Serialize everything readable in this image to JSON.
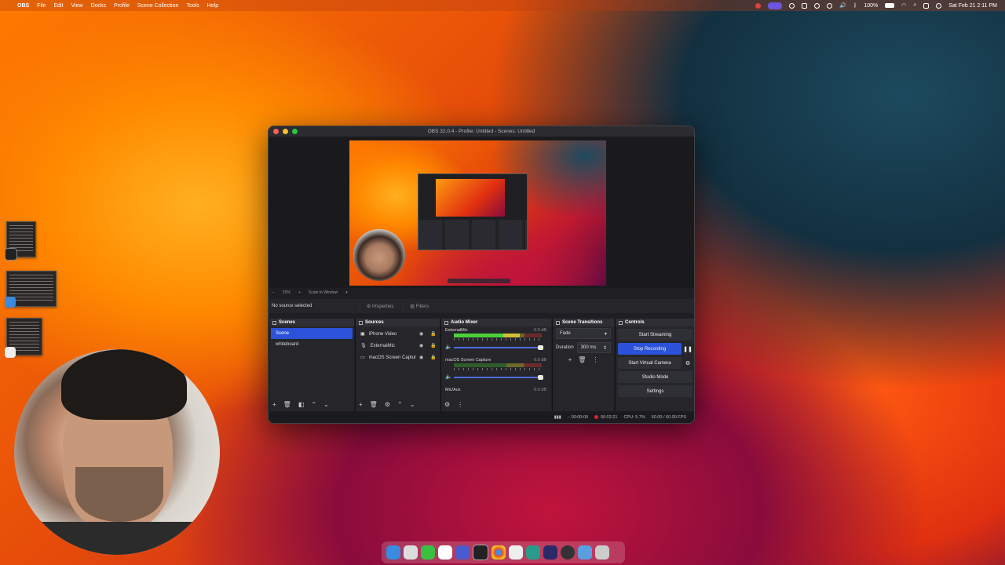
{
  "menubar": {
    "app_name": "OBS",
    "items": [
      "File",
      "Edit",
      "View",
      "Docks",
      "Profile",
      "Scene Collection",
      "Tools",
      "Help"
    ],
    "battery": "100%",
    "datetime": "Sat Feb 21  2:11 PM"
  },
  "window": {
    "title": "OBS 32.0.4 - Profile: Untitled - Scenes: Untitled",
    "zoom": "25%",
    "scale_mode": "Scale to Window"
  },
  "props_bar": {
    "no_source": "No source selected",
    "properties": "Properties",
    "filters": "Filters"
  },
  "scenes": {
    "title": "Scenes",
    "items": [
      {
        "label": "Scene",
        "selected": true
      },
      {
        "label": "whiteboard",
        "selected": false
      }
    ]
  },
  "sources": {
    "title": "Sources",
    "items": [
      {
        "label": "iPhone Video",
        "icon": "camera-icon"
      },
      {
        "label": "ExternalMic",
        "icon": "microphone-icon"
      },
      {
        "label": "macOS Screen Captur",
        "icon": "monitor-icon"
      }
    ]
  },
  "mixer": {
    "title": "Audio Mixer",
    "channels": [
      {
        "name": "ExternalMic",
        "db": "0.0 dB",
        "level": 0.75
      },
      {
        "name": "macOS Screen Capture",
        "db": "0.0 dB",
        "level": 0.0
      },
      {
        "name": "Mic/Aux",
        "db": "0.0 dB",
        "level": 0.0
      }
    ]
  },
  "transitions": {
    "title": "Scene Transitions",
    "selected": "Fade",
    "duration_label": "Duration",
    "duration_value": "300 ms"
  },
  "controls": {
    "title": "Controls",
    "start_streaming": "Start Streaming",
    "stop_recording": "Stop Recording",
    "start_virtual_camera": "Start Virtual Camera",
    "studio_mode": "Studio Mode",
    "settings": "Settings"
  },
  "status": {
    "stream_time": "00:00:00",
    "rec_time": "00:02:21",
    "cpu": "CPU: 5.7%",
    "fps": "60.00 / 60.00 FPS"
  },
  "colors": {
    "accent": "#2b52d9",
    "rec": "#e0202a",
    "panel": "#25252a"
  }
}
